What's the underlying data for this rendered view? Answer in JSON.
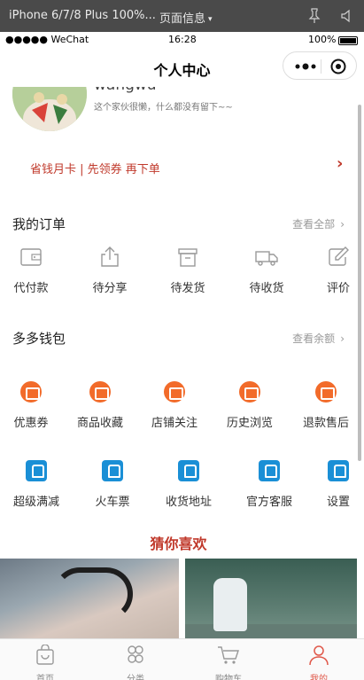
{
  "devtools": {
    "device": "iPhone 6/7/8 Plus 100%...",
    "page_info": "页面信息",
    "page_info_caret": "▾"
  },
  "status_bar": {
    "carrier": "●●●●● WeChat",
    "time": "16:28",
    "battery": "100%"
  },
  "nav": {
    "title": "个人中心"
  },
  "profile": {
    "username": "wangwu",
    "signature": "这个家伙很懒，什么都没有留下~~"
  },
  "promo": {
    "text": "省钱月卡 | 先领券 再下单",
    "arrow": "›"
  },
  "orders": {
    "title": "我的订单",
    "more": "查看全部",
    "chevron": "›",
    "items": [
      {
        "label": "代付款",
        "icon": "wallet-icon"
      },
      {
        "label": "待分享",
        "icon": "share-icon"
      },
      {
        "label": "待发货",
        "icon": "package-icon"
      },
      {
        "label": "待收货",
        "icon": "truck-icon"
      },
      {
        "label": "评价",
        "icon": "edit-icon"
      }
    ]
  },
  "wallet": {
    "title": "多多钱包",
    "more": "查看余额",
    "chevron": "›",
    "row1": [
      {
        "label": "优惠券",
        "icon": "coupon-icon"
      },
      {
        "label": "商品收藏",
        "icon": "coupon-icon"
      },
      {
        "label": "店铺关注",
        "icon": "coupon-icon"
      },
      {
        "label": "历史浏览",
        "icon": "coupon-icon"
      },
      {
        "label": "退款售后",
        "icon": "coupon-icon"
      }
    ],
    "row2": [
      {
        "label": "超级满减",
        "icon": "train-icon"
      },
      {
        "label": "火车票",
        "icon": "train-icon"
      },
      {
        "label": "收货地址",
        "icon": "train-icon"
      },
      {
        "label": "官方客服",
        "icon": "train-icon"
      },
      {
        "label": "设置",
        "icon": "train-icon"
      }
    ]
  },
  "guess": {
    "title": "猜你喜欢"
  },
  "tabbar": {
    "items": [
      {
        "label": "首页",
        "icon": "home-icon",
        "active": false
      },
      {
        "label": "分类",
        "icon": "category-icon",
        "active": false
      },
      {
        "label": "购物车",
        "icon": "cart-icon",
        "active": false
      },
      {
        "label": "我的",
        "icon": "profile-icon",
        "active": true
      }
    ]
  },
  "colors": {
    "accent": "#c0392b",
    "orange_badge": "#f26b2a",
    "blue_badge": "#1a8fd6",
    "tab_active": "#e0584a"
  }
}
